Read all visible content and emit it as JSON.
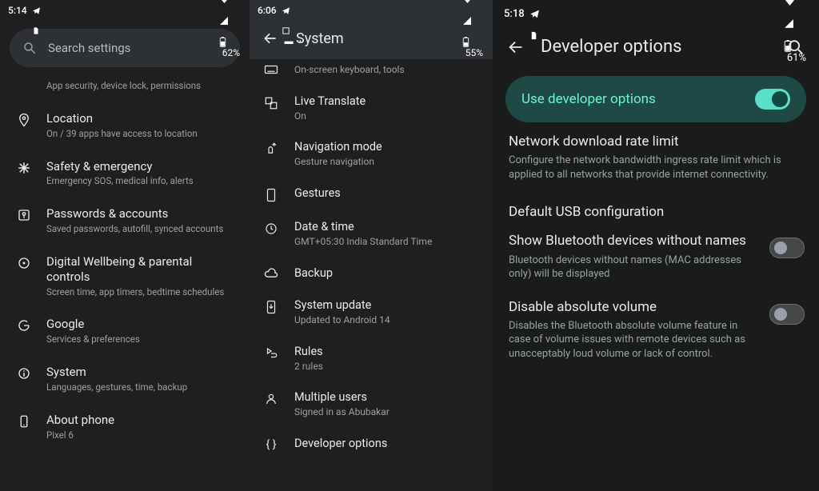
{
  "panel1": {
    "status": {
      "time": "5:14",
      "battery": "62%"
    },
    "search_placeholder": "Search settings",
    "items": [
      {
        "title": "",
        "sub": "App security, device lock, permissions"
      },
      {
        "title": "Location",
        "sub": "On / 39 apps have access to location"
      },
      {
        "title": "Safety & emergency",
        "sub": "Emergency SOS, medical info, alerts"
      },
      {
        "title": "Passwords & accounts",
        "sub": "Saved passwords, autofill, synced accounts"
      },
      {
        "title": "Digital Wellbeing & parental controls",
        "sub": "Screen time, app timers, bedtime schedules"
      },
      {
        "title": "Google",
        "sub": "Services & preferences"
      },
      {
        "title": "System",
        "sub": "Languages, gestures, time, backup"
      },
      {
        "title": "About phone",
        "sub": "Pixel 6"
      }
    ]
  },
  "panel2": {
    "status": {
      "time": "6:06",
      "battery": "55%"
    },
    "header": "System",
    "items": [
      {
        "title": "",
        "sub": "On-screen keyboard, tools"
      },
      {
        "title": "Live Translate",
        "sub": "On"
      },
      {
        "title": "Navigation mode",
        "sub": "Gesture navigation"
      },
      {
        "title": "Gestures",
        "sub": ""
      },
      {
        "title": "Date & time",
        "sub": "GMT+05:30 India Standard Time"
      },
      {
        "title": "Backup",
        "sub": ""
      },
      {
        "title": "System update",
        "sub": "Updated to Android 14"
      },
      {
        "title": "Rules",
        "sub": "2 rules"
      },
      {
        "title": "Multiple users",
        "sub": "Signed in as Abubakar"
      },
      {
        "title": "Developer options",
        "sub": ""
      }
    ]
  },
  "panel3": {
    "status": {
      "time": "5:18",
      "battery": "61%"
    },
    "header": "Developer options",
    "master_toggle_label": "Use developer options",
    "items": [
      {
        "title": "Network download rate limit",
        "sub": "Configure the network bandwidth ingress rate limit which is applied to all networks that provide internet connectivity."
      },
      {
        "title": "Default USB configuration",
        "sub": ""
      },
      {
        "title": "Show Bluetooth devices without names",
        "sub": "Bluetooth devices without names (MAC addresses only) will be displayed"
      },
      {
        "title": "Disable absolute volume",
        "sub": "Disables the Bluetooth absolute volume feature in case of volume issues with remote devices such as unacceptably loud volume or lack of control."
      }
    ]
  }
}
